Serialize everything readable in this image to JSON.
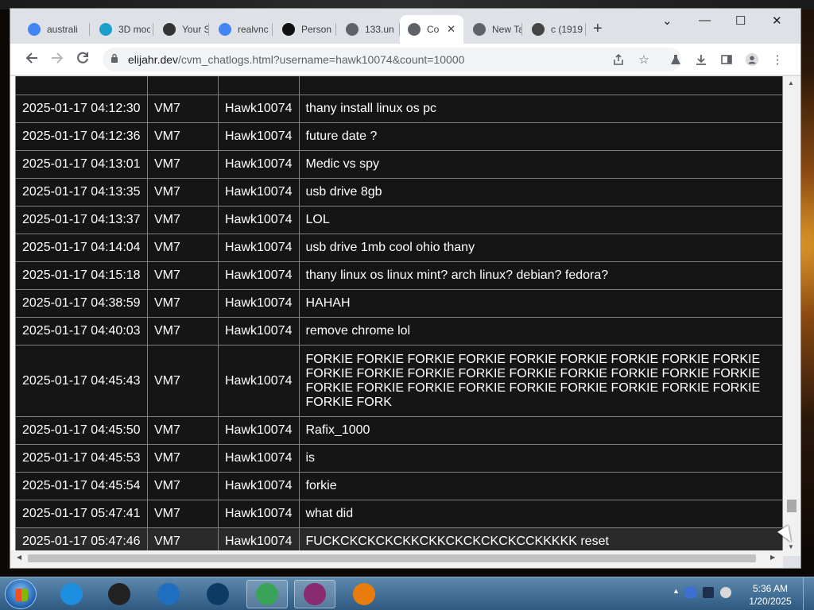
{
  "browser": {
    "tabs": [
      {
        "label": "australi",
        "favicon": "google-g-icon",
        "color": "#4285f4"
      },
      {
        "label": "3D moc",
        "favicon": "chatgpt-icon",
        "color": "#1a9fcc"
      },
      {
        "label": "Your Si",
        "favicon": "number-1-icon",
        "color": "#333333"
      },
      {
        "label": "realvnc",
        "favicon": "google-g-icon",
        "color": "#4285f4"
      },
      {
        "label": "Person",
        "favicon": "s-logo-icon",
        "color": "#111111"
      },
      {
        "label": "133.un",
        "favicon": "globe-icon",
        "color": "#5f6368"
      },
      {
        "label": "Co",
        "favicon": "globe-icon",
        "color": "#5f6368",
        "active": true
      },
      {
        "label": "New Ta",
        "favicon": "chrome-icon",
        "color": "#5f6368"
      },
      {
        "label": "c (1919",
        "favicon": "video-thumb-icon",
        "color": "#444444"
      }
    ],
    "new_tab_symbol": "+",
    "close_symbol": "✕",
    "window_controls": {
      "minimize": "—",
      "maximize": "☐",
      "close": "✕",
      "tab_search": "⌄"
    },
    "url_host": "elijahr.dev",
    "url_path": "/cvm_chatlogs.html?username=hawk10074&count=10000"
  },
  "chatlog": {
    "rows": [
      {
        "time": "2025-01-17 04:12:30",
        "vm": "VM7",
        "user": "Hawk10074",
        "message": "thany install linux os pc"
      },
      {
        "time": "2025-01-17 04:12:36",
        "vm": "VM7",
        "user": "Hawk10074",
        "message": "future date ?"
      },
      {
        "time": "2025-01-17 04:13:01",
        "vm": "VM7",
        "user": "Hawk10074",
        "message": "Medic vs spy"
      },
      {
        "time": "2025-01-17 04:13:35",
        "vm": "VM7",
        "user": "Hawk10074",
        "message": "usb drive 8gb"
      },
      {
        "time": "2025-01-17 04:13:37",
        "vm": "VM7",
        "user": "Hawk10074",
        "message": "LOL"
      },
      {
        "time": "2025-01-17 04:14:04",
        "vm": "VM7",
        "user": "Hawk10074",
        "message": "usb drive 1mb cool ohio thany"
      },
      {
        "time": "2025-01-17 04:15:18",
        "vm": "VM7",
        "user": "Hawk10074",
        "message": "thany linux os linux mint? arch linux? debian? fedora?"
      },
      {
        "time": "2025-01-17 04:38:59",
        "vm": "VM7",
        "user": "Hawk10074",
        "message": "HAHAH"
      },
      {
        "time": "2025-01-17 04:40:03",
        "vm": "VM7",
        "user": "Hawk10074",
        "message": "remove chrome lol"
      },
      {
        "time": "2025-01-17 04:45:43",
        "vm": "VM7",
        "user": "Hawk10074",
        "message": "FORKIE FORKIE FORKIE FORKIE FORKIE FORKIE FORKIE FORKIE FORKIE FORKIE FORKIE FORKIE FORKIE FORKIE FORKIE FORKIE FORKIE FORKIE FORKIE FORKIE FORKIE FORKIE FORKIE FORKIE FORKIE FORKIE FORKIE FORKIE FORK"
      },
      {
        "time": "2025-01-17 04:45:50",
        "vm": "VM7",
        "user": "Hawk10074",
        "message": "Rafix_1000"
      },
      {
        "time": "2025-01-17 04:45:53",
        "vm": "VM7",
        "user": "Hawk10074",
        "message": "is"
      },
      {
        "time": "2025-01-17 04:45:54",
        "vm": "VM7",
        "user": "Hawk10074",
        "message": "forkie"
      },
      {
        "time": "2025-01-17 05:47:41",
        "vm": "VM7",
        "user": "Hawk10074",
        "message": "what did"
      },
      {
        "time": "2025-01-17 05:47:46",
        "vm": "VM7",
        "user": "Hawk10074",
        "message": "FUCKCKCKCKCKKCKKCKCKCKCKCCKKKKK reset"
      }
    ]
  },
  "taskbar": {
    "apps": [
      {
        "name": "internet-explorer-icon",
        "color": "#1e8fe0"
      },
      {
        "name": "terminal-icon",
        "color": "#222222"
      },
      {
        "name": "media-player-icon",
        "color": "#1f6fc1"
      },
      {
        "name": "globe-app-icon",
        "color": "#0e3b66"
      },
      {
        "name": "chrome-taskbar-icon",
        "color": "#3aa35a",
        "open": true
      },
      {
        "name": "winrar-icon",
        "color": "#8b2b6f",
        "open": true
      },
      {
        "name": "blender-icon",
        "color": "#e87d0d"
      }
    ],
    "time": "5:36 AM",
    "date": "1/20/2025"
  }
}
